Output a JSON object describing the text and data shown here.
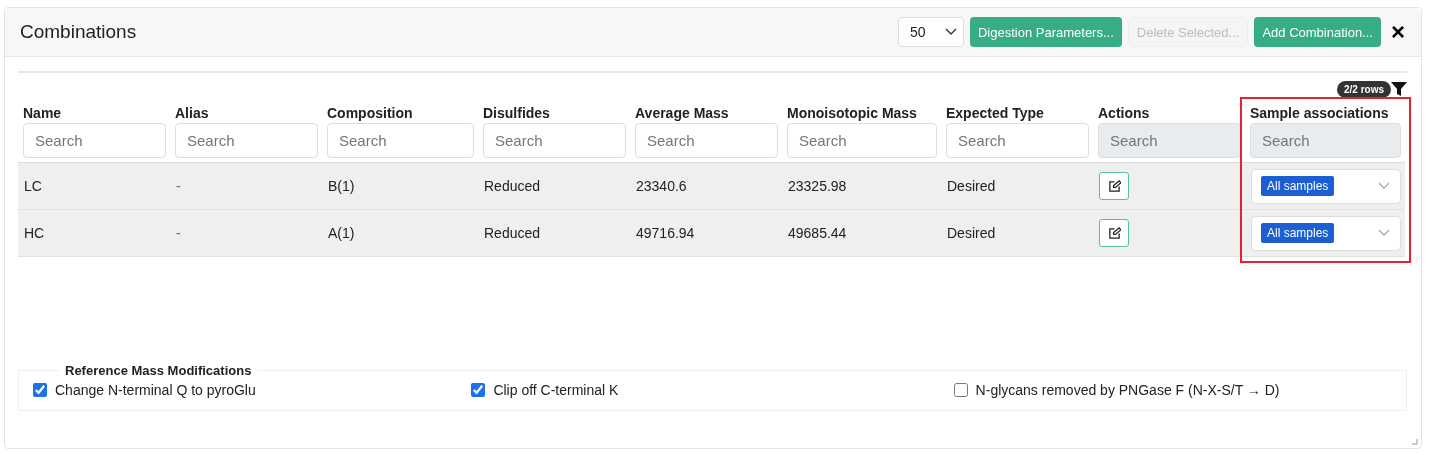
{
  "title": "Combinations",
  "page_size": "50",
  "buttons": [
    {
      "label": "Digestion Parameters...",
      "disabled": false
    },
    {
      "label": "Delete Selected...",
      "disabled": true
    },
    {
      "label": "Add Combination...",
      "disabled": false
    }
  ],
  "close": "×",
  "row_count": "2/2 rows",
  "columns": [
    {
      "name": "Name",
      "placeholder": "Search",
      "disabled": false,
      "highlighted": false
    },
    {
      "name": "Alias",
      "placeholder": "Search",
      "disabled": false,
      "highlighted": false
    },
    {
      "name": "Composition",
      "placeholder": "Search",
      "disabled": false,
      "highlighted": false
    },
    {
      "name": "Disulfides",
      "placeholder": "Search",
      "disabled": false,
      "highlighted": false
    },
    {
      "name": "Average Mass",
      "placeholder": "Search",
      "disabled": false,
      "highlighted": false
    },
    {
      "name": "Monoisotopic Mass",
      "placeholder": "Search",
      "disabled": false,
      "highlighted": false
    },
    {
      "name": "Expected Type",
      "placeholder": "Search",
      "disabled": false,
      "highlighted": false
    },
    {
      "name": "Actions",
      "placeholder": "Search",
      "disabled": true,
      "highlighted": false
    },
    {
      "name": "Sample associations",
      "placeholder": "Search",
      "disabled": true,
      "highlighted": true
    }
  ],
  "rows": [
    {
      "cells": [
        "LC",
        "-",
        "B(1)",
        "Reduced",
        "23340.6",
        "23325.98",
        "Desired"
      ],
      "samples": "All samples"
    },
    {
      "cells": [
        "HC",
        "-",
        "A(1)",
        "Reduced",
        "49716.94",
        "49685.44",
        "Desired"
      ],
      "samples": "All samples"
    }
  ],
  "modifications": {
    "legend": "Reference Mass Modifications",
    "options": [
      {
        "label": "Change N-terminal Q to pyroGlu",
        "checked": true
      },
      {
        "label": "Clip off C-terminal K",
        "checked": true
      },
      {
        "label": "N-glycans removed by PNGase F (N-X-S/T → D)",
        "checked": false
      }
    ]
  }
}
